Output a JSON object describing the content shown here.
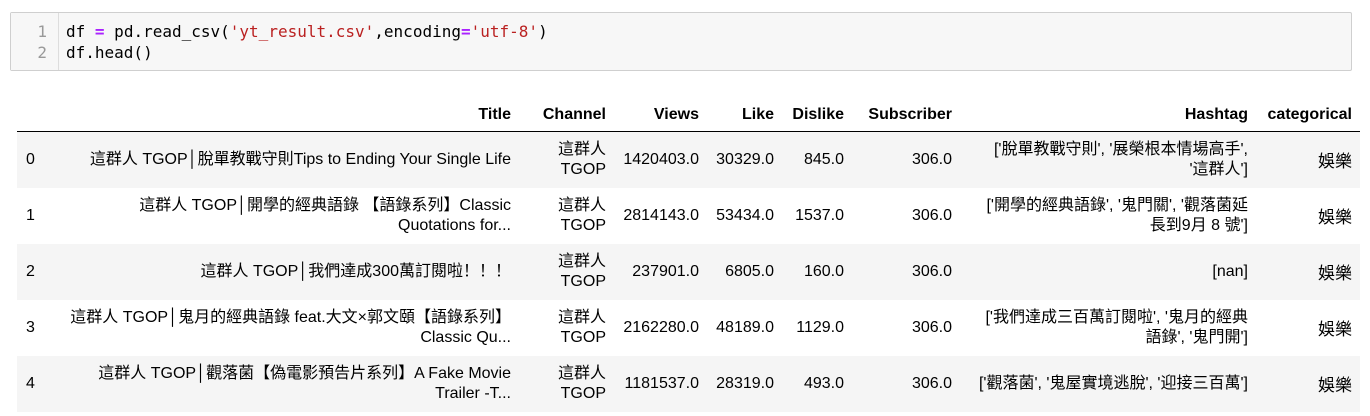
{
  "code": {
    "lines": [
      {
        "num": "1",
        "parts": [
          {
            "t": "df ",
            "c": ""
          },
          {
            "t": "=",
            "c": "kw-eq"
          },
          {
            "t": " pd.read_csv(",
            "c": ""
          },
          {
            "t": "'yt_result.csv'",
            "c": "str"
          },
          {
            "t": ",encoding",
            "c": ""
          },
          {
            "t": "=",
            "c": "kw-eq"
          },
          {
            "t": "'utf-8'",
            "c": "str"
          },
          {
            "t": ")",
            "c": ""
          }
        ]
      },
      {
        "num": "2",
        "parts": [
          {
            "t": "df.head()",
            "c": ""
          }
        ]
      }
    ]
  },
  "table": {
    "columns": [
      "",
      "Title",
      "Channel",
      "Views",
      "Like",
      "Dislike",
      "Subscriber",
      "Hashtag",
      "categorical"
    ],
    "rows": [
      {
        "index": "0",
        "title": [
          "這群人 TGOP│脫單教戰守則Tips to Ending Your Single Life"
        ],
        "channel": [
          "這群人",
          "TGOP"
        ],
        "views": "1420403.0",
        "like": "30329.0",
        "dislike": "845.0",
        "subscriber": "306.0",
        "hashtag": [
          "['脫單教戰守則', '展榮根本情場高手',",
          "'這群人']"
        ],
        "categorical": "娛樂"
      },
      {
        "index": "1",
        "title": [
          "這群人 TGOP│開學的經典語錄 【語錄系列】Classic",
          "Quotations for..."
        ],
        "channel": [
          "這群人",
          "TGOP"
        ],
        "views": "2814143.0",
        "like": "53434.0",
        "dislike": "1537.0",
        "subscriber": "306.0",
        "hashtag": [
          "['開學的經典語錄', '鬼門關', '觀落菌延",
          "長到9月 8 號']"
        ],
        "categorical": "娛樂"
      },
      {
        "index": "2",
        "title": [
          "這群人 TGOP│我們達成300萬訂閱啦！！！"
        ],
        "channel": [
          "這群人",
          "TGOP"
        ],
        "views": "237901.0",
        "like": "6805.0",
        "dislike": "160.0",
        "subscriber": "306.0",
        "hashtag": [
          "[nan]"
        ],
        "categorical": "娛樂"
      },
      {
        "index": "3",
        "title": [
          "這群人 TGOP│鬼月的經典語錄 feat.大文×郭文頤【語錄系列】",
          "Classic Qu..."
        ],
        "channel": [
          "這群人",
          "TGOP"
        ],
        "views": "2162280.0",
        "like": "48189.0",
        "dislike": "1129.0",
        "subscriber": "306.0",
        "hashtag": [
          "['我們達成三百萬訂閱啦', '鬼月的經典",
          "語錄', '鬼門開']"
        ],
        "categorical": "娛樂"
      },
      {
        "index": "4",
        "title": [
          "這群人 TGOP│觀落菌【偽電影預告片系列】A Fake Movie",
          "Trailer -T..."
        ],
        "channel": [
          "這群人",
          "TGOP"
        ],
        "views": "1181537.0",
        "like": "28319.0",
        "dislike": "493.0",
        "subscriber": "306.0",
        "hashtag": [
          "['觀落菌', '鬼屋實境逃脫', '迎接三百萬']"
        ],
        "categorical": "娛樂"
      }
    ]
  }
}
